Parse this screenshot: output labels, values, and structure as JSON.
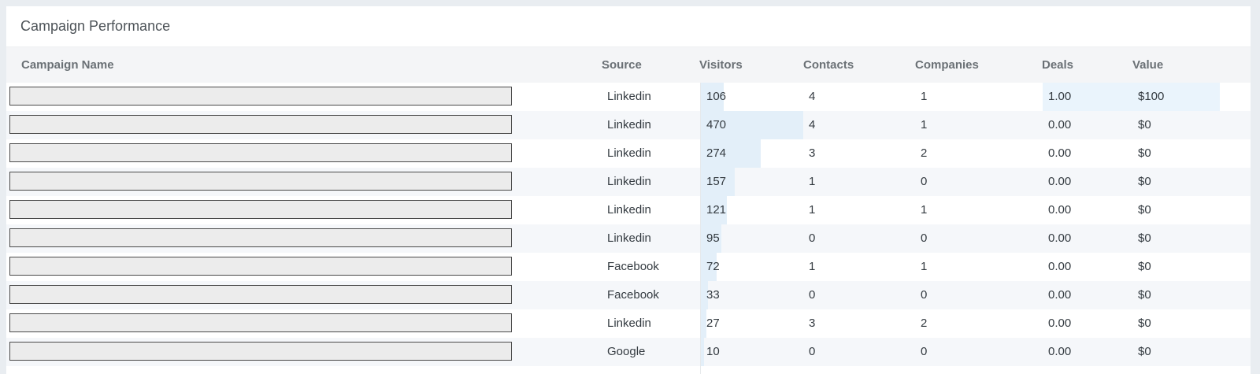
{
  "panel": {
    "title": "Campaign Performance"
  },
  "columns": {
    "name": "Campaign Name",
    "source": "Source",
    "visitors": "Visitors",
    "contacts": "Contacts",
    "companies": "Companies",
    "deals": "Deals",
    "value": "Value"
  },
  "visitors_max": 470,
  "rows": [
    {
      "source": "Linkedin",
      "visitors": "106",
      "visitors_n": 106,
      "contacts": "4",
      "companies": "1",
      "deals": "1.00",
      "value": "$100",
      "highlight": true
    },
    {
      "source": "Linkedin",
      "visitors": "470",
      "visitors_n": 470,
      "contacts": "4",
      "companies": "1",
      "deals": "0.00",
      "value": "$0"
    },
    {
      "source": "Linkedin",
      "visitors": "274",
      "visitors_n": 274,
      "contacts": "3",
      "companies": "2",
      "deals": "0.00",
      "value": "$0"
    },
    {
      "source": "Linkedin",
      "visitors": "157",
      "visitors_n": 157,
      "contacts": "1",
      "companies": "0",
      "deals": "0.00",
      "value": "$0"
    },
    {
      "source": "Linkedin",
      "visitors": "121",
      "visitors_n": 121,
      "contacts": "1",
      "companies": "1",
      "deals": "0.00",
      "value": "$0"
    },
    {
      "source": "Linkedin",
      "visitors": "95",
      "visitors_n": 95,
      "contacts": "0",
      "companies": "0",
      "deals": "0.00",
      "value": "$0"
    },
    {
      "source": "Facebook",
      "visitors": "72",
      "visitors_n": 72,
      "contacts": "1",
      "companies": "1",
      "deals": "0.00",
      "value": "$0"
    },
    {
      "source": "Facebook",
      "visitors": "33",
      "visitors_n": 33,
      "contacts": "0",
      "companies": "0",
      "deals": "0.00",
      "value": "$0"
    },
    {
      "source": "Linkedin",
      "visitors": "27",
      "visitors_n": 27,
      "contacts": "3",
      "companies": "2",
      "deals": "0.00",
      "value": "$0"
    },
    {
      "source": "Google",
      "visitors": "10",
      "visitors_n": 10,
      "contacts": "0",
      "companies": "0",
      "deals": "0.00",
      "value": "$0"
    }
  ]
}
